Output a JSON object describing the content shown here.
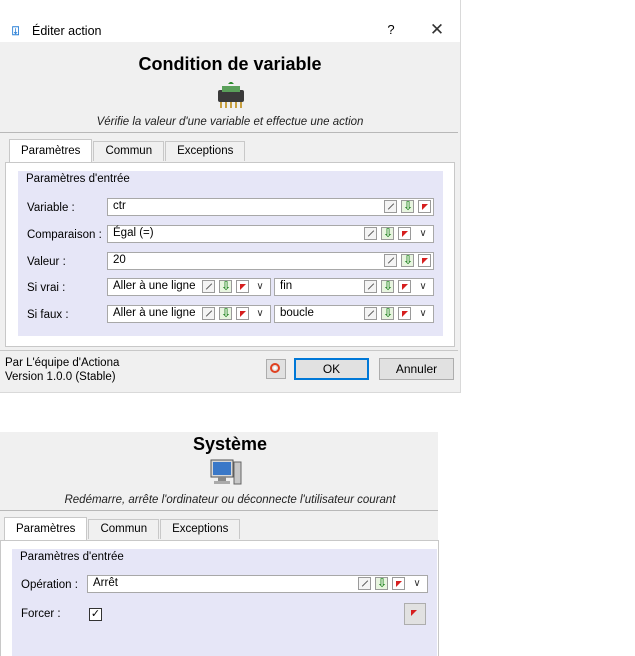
{
  "dialog1": {
    "window_title": "Éditer action",
    "help_label": "?",
    "close_label": "✕",
    "heading": "Condition de variable",
    "icon": "condition-chip-icon",
    "description": "Vérifie la valeur d'une variable et effectue une action",
    "tabs": [
      "Paramètres",
      "Commun",
      "Exceptions"
    ],
    "group_title": "Paramètres d'entrée",
    "rows": {
      "variable": {
        "label": "Variable :",
        "value": "ctr"
      },
      "comparaison": {
        "label": "Comparaison :",
        "value": "Égal (=)"
      },
      "valeur": {
        "label": "Valeur :",
        "value": "20"
      },
      "si_vrai": {
        "label": "Si vrai :",
        "action": "Aller à une ligne",
        "target": "fin"
      },
      "si_faux": {
        "label": "Si faux :",
        "action": "Aller à une ligne",
        "target": "boucle"
      }
    },
    "footer": {
      "author": "Par L'équipe d'Actiona",
      "version": "Version 1.0.0 (Stable)",
      "ok_label": "OK",
      "cancel_label": "Annuler"
    }
  },
  "dialog2": {
    "heading": "Système",
    "icon": "computer-icon",
    "description": "Redémarre, arrête l'ordinateur ou déconnecte l'utilisateur courant",
    "tabs": [
      "Paramètres",
      "Commun",
      "Exceptions"
    ],
    "group_title": "Paramètres d'entrée",
    "rows": {
      "operation": {
        "label": "Opération :",
        "value": "Arrêt"
      },
      "forcer": {
        "label": "Forcer :",
        "checked": true,
        "check_glyph": "✓"
      }
    }
  },
  "colors": {
    "group_bg": "#e6e6f7",
    "accent": "#0078d7",
    "variable_green": "#2e8b2e",
    "delete_red": "#d61f1f"
  }
}
